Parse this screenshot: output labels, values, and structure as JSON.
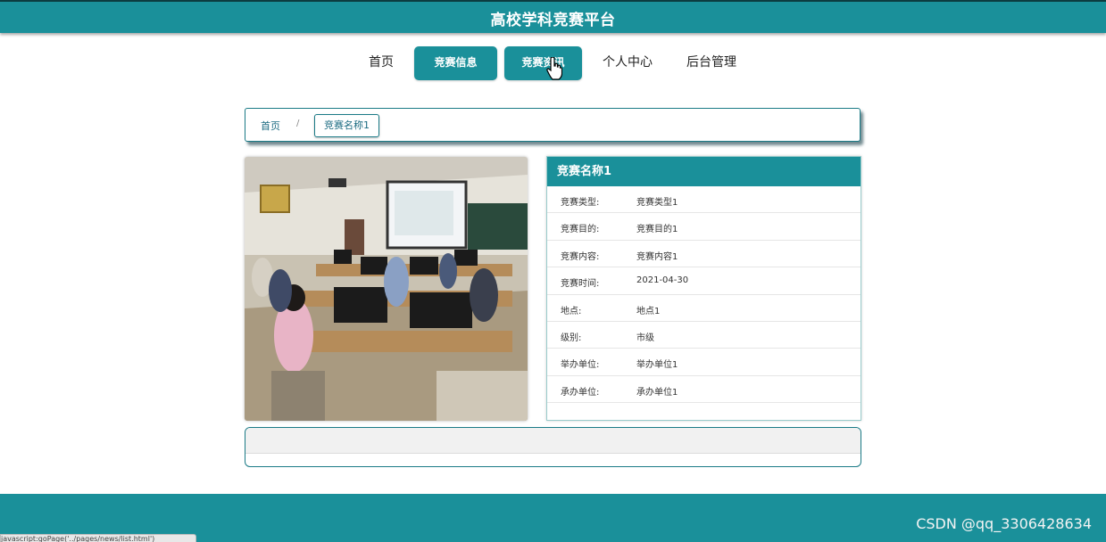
{
  "header": {
    "title": "高校学科竞赛平台"
  },
  "nav": {
    "items": [
      {
        "label": "首页"
      },
      {
        "label": "竞赛信息"
      },
      {
        "label": "竞赛资讯"
      },
      {
        "label": "个人中心"
      },
      {
        "label": "后台管理"
      }
    ]
  },
  "breadcrumb": {
    "home": "首页",
    "separator": "/",
    "current": "竞赛名称1"
  },
  "detail": {
    "title": "竞赛名称1",
    "rows": [
      {
        "key": "竞赛类型:",
        "value": "竞赛类型1"
      },
      {
        "key": "竞赛目的:",
        "value": "竞赛目的1"
      },
      {
        "key": "竞赛内容:",
        "value": "竞赛内容1"
      },
      {
        "key": "竞赛时间:",
        "value": "2021-04-30"
      },
      {
        "key": "地点:",
        "value": "地点1"
      },
      {
        "key": "级别:",
        "value": "市级"
      },
      {
        "key": "举办单位:",
        "value": "举办单位1"
      },
      {
        "key": "承办单位:",
        "value": "承办单位1"
      }
    ]
  },
  "footer": {
    "watermark": "CSDN @qq_3306428634"
  },
  "status_bar": {
    "url": "javascript:goPage('../pages/news/list.html')"
  },
  "colors": {
    "primary": "#1a909a",
    "footer": "#1a909a"
  }
}
